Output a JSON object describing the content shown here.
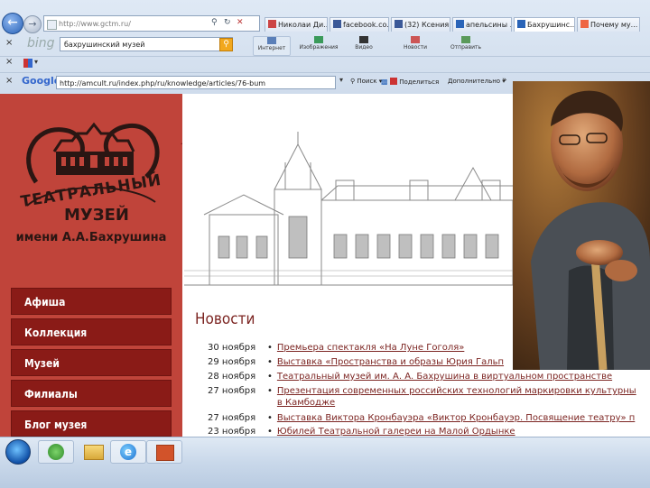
{
  "browser": {
    "address": "http://www.gctm.ru/",
    "tabs": [
      "Николаи Ди...",
      "facebook.co...",
      "(32) Ксения ...",
      "апельсины ...",
      "Бахрушинс...",
      "Почему му..."
    ],
    "bing_logo": "bing",
    "bing_query": "бахрушинский музей",
    "toolbar_buttons": [
      "Интернет",
      "Изображения",
      "Видео",
      "Новости",
      "Отправить"
    ],
    "google_logo": "Google",
    "google_address": "http://amcult.ru/index.php/ru/knowledge/articles/76-bum",
    "google_buttons": [
      "Поиск",
      "Поделиться",
      "Дополнительно"
    ]
  },
  "site": {
    "logo_lines": [
      "ТЕАТРАЛЬНЫЙ",
      "МУЗЕЙ",
      "имени А.А.Бахрушина"
    ],
    "menu": [
      "Афиша",
      "Коллекция",
      "Музей",
      "Филиалы",
      "Блог музея"
    ],
    "news_title": "Новости",
    "news": [
      {
        "date": "30 ноября",
        "title": "Премьера спектакля «На Луне Гоголя»"
      },
      {
        "date": "29 ноября",
        "title": "Выставка «Пространства и образы Юрия Гальп"
      },
      {
        "date": "28 ноября",
        "title": "Театральный музей им. А. А. Бахрушина в виртуальном пространстве"
      },
      {
        "date": "27 ноября",
        "title": "Презентация современных российских технологий маркировки культурны"
      },
      {
        "date": "",
        "title": "в Камбодже"
      },
      {
        "date": "27 ноября",
        "title": "Выставка Виктора Кронбауэра «Виктор Кронбауэр. Посвящение театру» п"
      },
      {
        "date": "23 ноября",
        "title": "Юбилей Театральной галереи на Малой Ордынке"
      }
    ]
  },
  "colors": {
    "accent": "#c0443a",
    "menu_bg": "#8a1b17",
    "link": "#7c2522"
  },
  "icons": [
    "back-icon",
    "forward-icon",
    "search-icon",
    "start-orb-icon",
    "utorrent-icon",
    "folder-icon",
    "ie-icon",
    "powerpoint-icon"
  ]
}
